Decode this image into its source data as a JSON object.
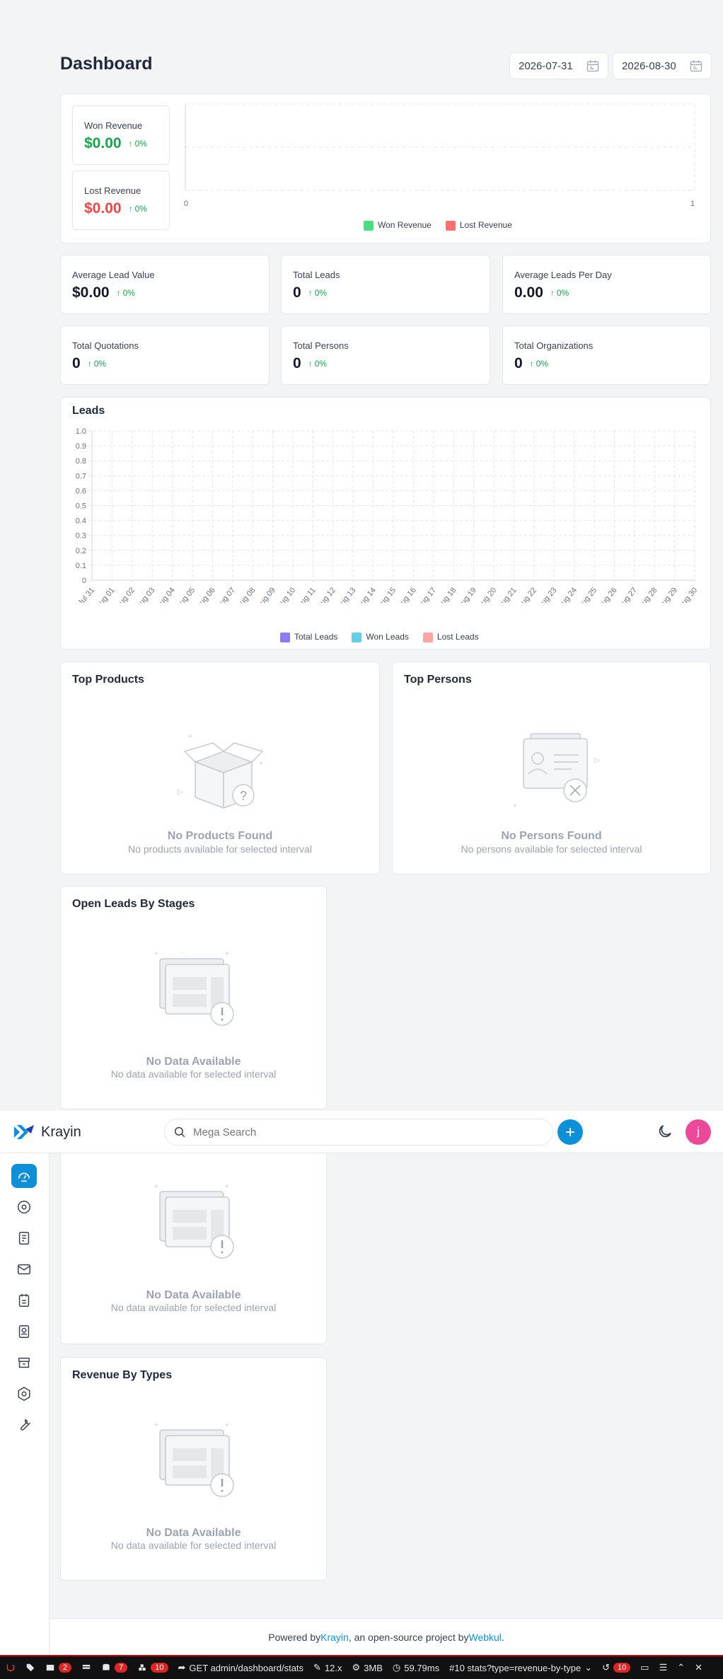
{
  "page": {
    "title": "Dashboard",
    "date_start": "2026-07-31",
    "date_end": "2026-08-30"
  },
  "revenue": {
    "won_label": "Won Revenue",
    "won_value": "$0.00",
    "won_change": "0%",
    "lost_label": "Lost Revenue",
    "lost_value": "$0.00",
    "lost_change": "0%",
    "axis_min": "0",
    "axis_max": "1",
    "legend_won": "Won Revenue",
    "legend_lost": "Lost Revenue"
  },
  "stats": [
    {
      "label": "Average Lead Value",
      "value": "$0.00",
      "change": "0%"
    },
    {
      "label": "Total Leads",
      "value": "0",
      "change": "0%"
    },
    {
      "label": "Average Leads Per Day",
      "value": "0.00",
      "change": "0%"
    },
    {
      "label": "Total Quotations",
      "value": "0",
      "change": "0%"
    },
    {
      "label": "Total Persons",
      "value": "0",
      "change": "0%"
    },
    {
      "label": "Total Organizations",
      "value": "0",
      "change": "0%"
    }
  ],
  "leads_chart": {
    "title": "Leads",
    "legend": [
      "Total Leads",
      "Won Leads",
      "Lost Leads"
    ]
  },
  "chart_data": {
    "type": "line",
    "title": "Leads",
    "x": [
      "Jul 31",
      "Aug 01",
      "Aug 02",
      "Aug 03",
      "Aug 04",
      "Aug 05",
      "Aug 06",
      "Aug 07",
      "Aug 08",
      "Aug 09",
      "Aug 10",
      "Aug 11",
      "Aug 12",
      "Aug 13",
      "Aug 14",
      "Aug 15",
      "Aug 16",
      "Aug 17",
      "Aug 18",
      "Aug 19",
      "Aug 20",
      "Aug 21",
      "Aug 22",
      "Aug 23",
      "Aug 24",
      "Aug 25",
      "Aug 26",
      "Aug 27",
      "Aug 28",
      "Aug 29",
      "Aug 30"
    ],
    "yticks": [
      "0",
      "0.1",
      "0.2",
      "0.3",
      "0.4",
      "0.5",
      "0.6",
      "0.7",
      "0.8",
      "0.9",
      "1.0"
    ],
    "ylim": [
      0,
      1
    ],
    "series": [
      {
        "name": "Total Leads",
        "color": "#8b7cf6",
        "values": []
      },
      {
        "name": "Won Leads",
        "color": "#63cfe6",
        "values": []
      },
      {
        "name": "Lost Leads",
        "color": "#fca5a5",
        "values": []
      }
    ],
    "grid": true,
    "legend_position": "bottom"
  },
  "top_products": {
    "title": "Top Products",
    "empty_title": "No Products Found",
    "empty_sub": "No products available for selected interval"
  },
  "top_persons": {
    "title": "Top Persons",
    "empty_title": "No Persons Found",
    "empty_sub": "No persons available for selected interval"
  },
  "open_leads": {
    "title": "Open Leads By Stages",
    "empty_title": "No Data Available",
    "empty_sub": "No data available for selected interval"
  },
  "scrolled_card": {
    "empty_title": "No Data Available",
    "empty_sub": "No data available for selected interval"
  },
  "revenue_types": {
    "title": "Revenue By Types",
    "empty_title": "No Data Available",
    "empty_sub": "No data available for selected interval"
  },
  "header": {
    "brand": "Krayin",
    "search_placeholder": "Mega Search",
    "avatar_letter": "j"
  },
  "footer": {
    "prefix": "Powered by ",
    "link1": "Krayin",
    "middle": ", an open-source project by ",
    "link2": "Webkul",
    "suffix": "."
  },
  "debugbar": {
    "messages_count": "2",
    "queries_count": "7",
    "models_count": "10",
    "request": "GET admin/dashboard/stats",
    "php": "12.x",
    "memory": "3MB",
    "time": "59.79ms",
    "request_select": "#10 stats?type=revenue-by-type",
    "history_count": "10"
  },
  "colors": {
    "accent": "#0e90d9",
    "won": "#4ade80",
    "lost": "#f87171",
    "avatar": "#ec4899"
  }
}
